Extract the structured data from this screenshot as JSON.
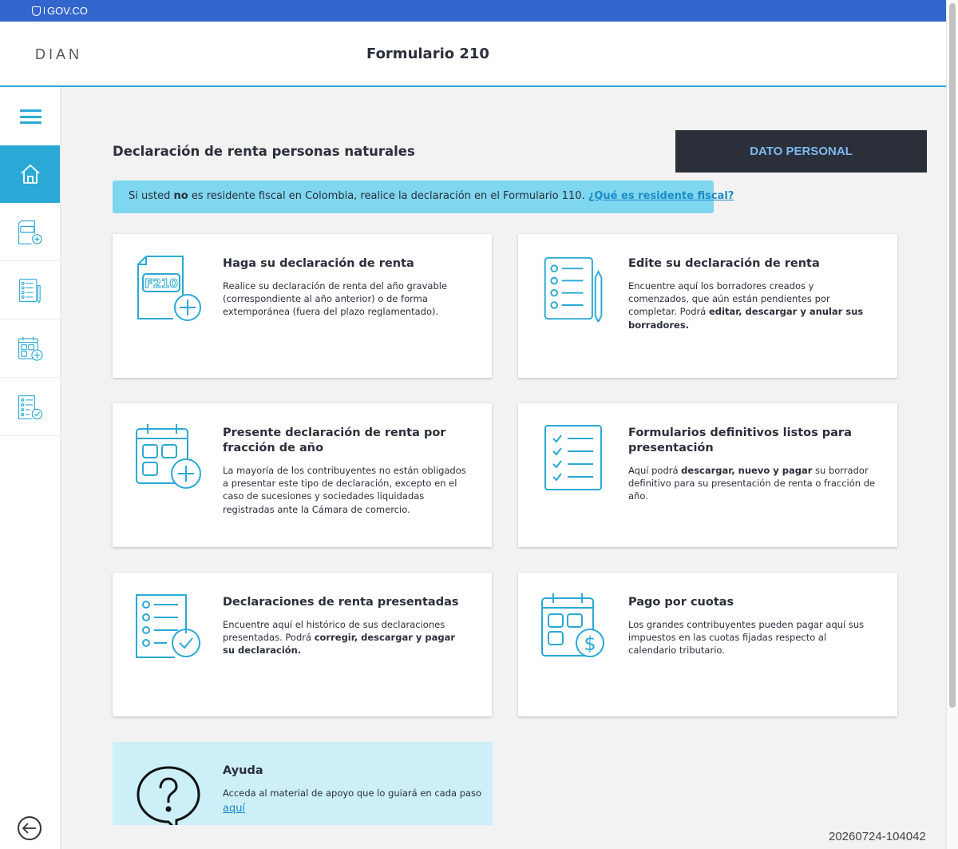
{
  "gov": {
    "label": "GOV.CO",
    "color": "#3366cc"
  },
  "header": {
    "logo": "DIAN",
    "title": "Formulario 210"
  },
  "sidebar": {
    "menu_icon": "hamburger-icon",
    "items": [
      {
        "icon": "home-icon",
        "active": true
      },
      {
        "icon": "f210-add-icon"
      },
      {
        "icon": "edit-list-icon"
      },
      {
        "icon": "calendar-add-icon"
      },
      {
        "icon": "list-check-icon"
      }
    ],
    "back_icon": "back-arrow-icon"
  },
  "main": {
    "title": "Declaración de renta personas naturales",
    "dato_button": "DATO PERSONAL",
    "notice": {
      "pre": "Si usted ",
      "bold": "no",
      "post": " es residente fiscal en Colombia, realice la declaración en el Formulario 110. ",
      "link": "¿Qué es residente fiscal?"
    }
  },
  "cards": [
    {
      "icon": "f210-add-icon",
      "title": "Haga su declaración de renta",
      "desc": [
        {
          "t": "Realice su declaración de renta del año gravable (correspondiente al año anterior) o de forma extemporánea (fuera del plazo reglamentado)."
        }
      ]
    },
    {
      "icon": "edit-list-icon",
      "title": "Edite su declaración de renta",
      "desc": [
        {
          "t": "Encuentre aquí los borradores creados y comenzados, que aún están pendientes por completar. Podrá "
        },
        {
          "b": "editar, descargar y anular sus borradores."
        }
      ]
    },
    {
      "icon": "calendar-add-icon",
      "title": "Presente declaración de renta por fracción de año",
      "desc": [
        {
          "t": "La mayoría de los contribuyentes no están obligados a presentar este tipo de declaración, excepto en el caso de sucesiones y sociedades liquidadas registradas ante la Cámara de comercio."
        }
      ]
    },
    {
      "icon": "checklist-icon",
      "title": "Formularios definitivos listos para presentación",
      "desc": [
        {
          "t": "Aquí podrá "
        },
        {
          "b": "descargar, nuevo y pagar"
        },
        {
          "t": " su borrador definitivo para su presentación de renta o fracción de año."
        }
      ]
    },
    {
      "icon": "list-check-icon",
      "title": "Declaraciones de renta presentadas",
      "desc": [
        {
          "t": "Encuentre aquí el histórico de sus declaraciones presentadas. Podrá "
        },
        {
          "b": "corregir, descargar y pagar su declaración."
        }
      ]
    },
    {
      "icon": "calendar-dollar-icon",
      "title": "Pago por cuotas",
      "desc": [
        {
          "t": "Los grandes contribuyentes pueden pagar aquí sus impuestos en las cuotas fijadas respecto al calendario tributario."
        }
      ]
    }
  ],
  "help": {
    "icon": "question-bubble-icon",
    "title": "Ayuda",
    "text": "Acceda al material de apoyo que lo guiará en cada paso",
    "link": "aquí"
  },
  "timestamp": "20260724-104042",
  "colors": {
    "accent": "#2aa9d6",
    "dark": "#2b2f3a",
    "notice_bg": "#7fd6ef",
    "help_bg": "#cceff8"
  }
}
